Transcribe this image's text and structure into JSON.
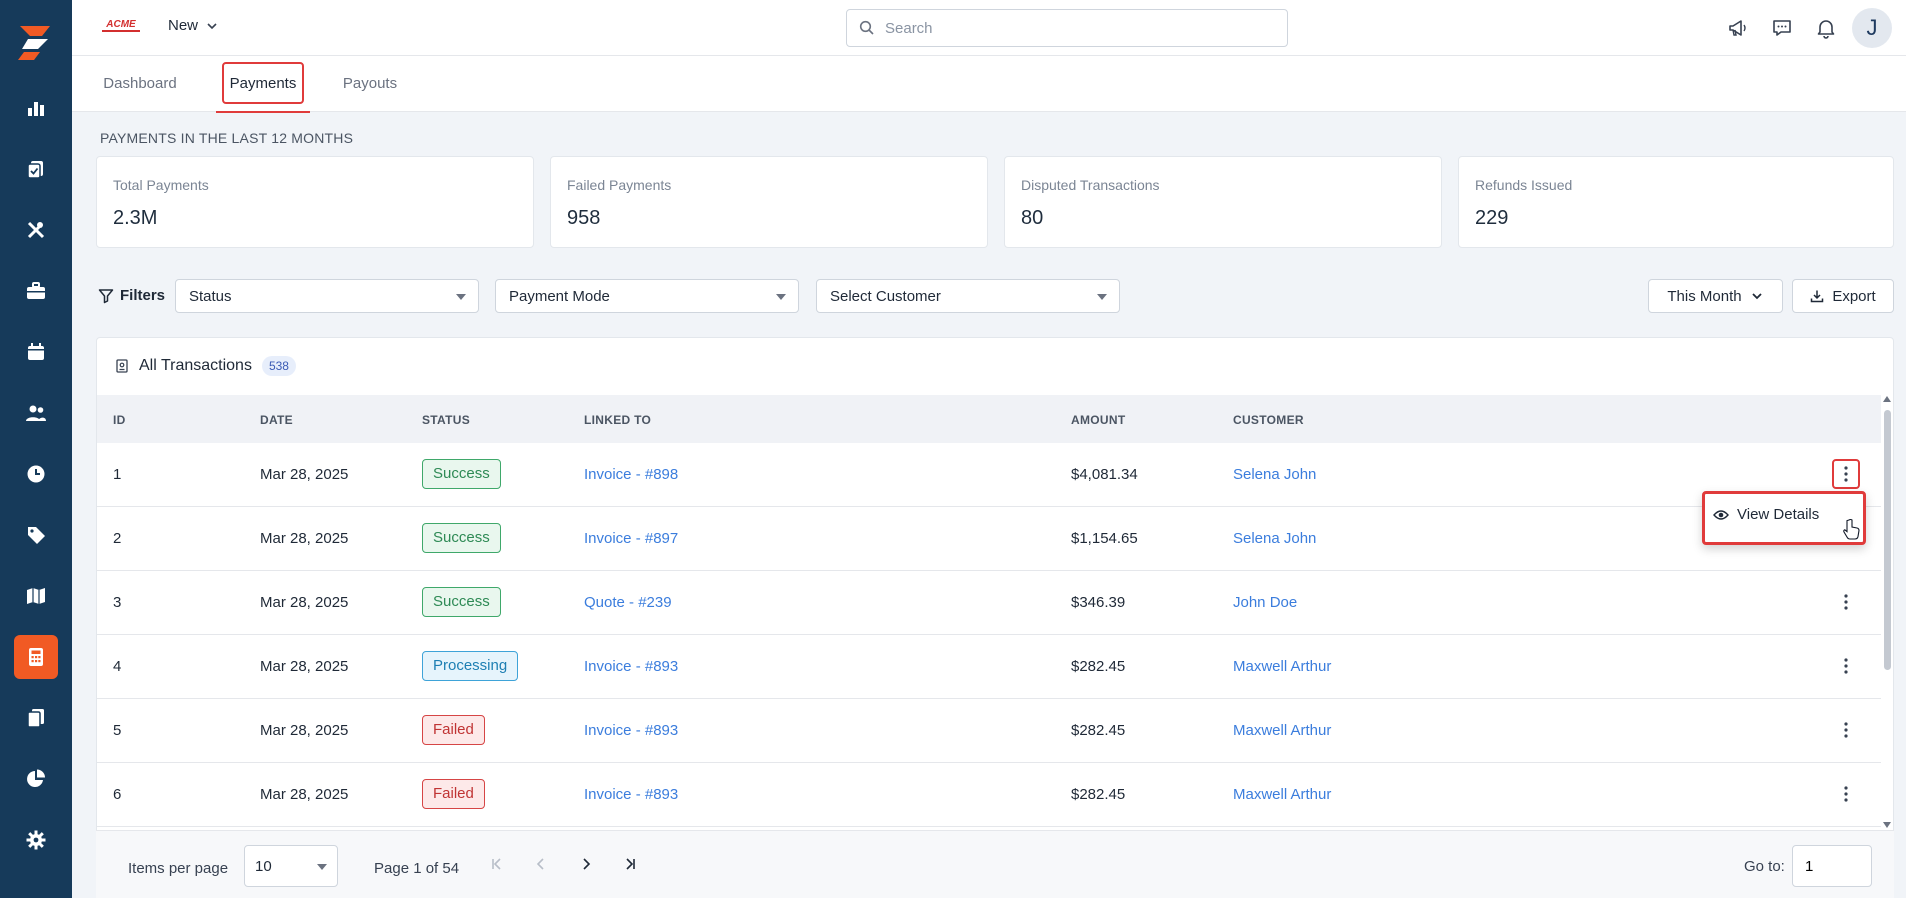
{
  "brand": {
    "logo_text": "ACME",
    "primary_color": "#163a5a",
    "accent_color": "#f15a24",
    "highlight_color": "#e03b3b"
  },
  "sidebar": {
    "items": [
      {
        "icon": "bar-chart-icon",
        "active": false
      },
      {
        "icon": "clipboard-check-icon",
        "active": false
      },
      {
        "icon": "tools-icon",
        "active": false
      },
      {
        "icon": "briefcase-icon",
        "active": false
      },
      {
        "icon": "calendar-icon",
        "active": false
      },
      {
        "icon": "users-icon",
        "active": false
      },
      {
        "icon": "clock-icon",
        "active": false
      },
      {
        "icon": "tag-icon",
        "active": false
      },
      {
        "icon": "map-icon",
        "active": false
      },
      {
        "icon": "calculator-icon",
        "active": true
      },
      {
        "icon": "documents-icon",
        "active": false
      },
      {
        "icon": "pie-chart-icon",
        "active": false
      },
      {
        "icon": "gear-icon",
        "active": false
      }
    ]
  },
  "header": {
    "new_label": "New",
    "search_placeholder": "Search",
    "avatar_initial": "J",
    "icons": [
      "megaphone-icon",
      "chat-icon",
      "bell-icon"
    ]
  },
  "tabs": [
    {
      "label": "Dashboard",
      "active": false
    },
    {
      "label": "Payments",
      "active": true
    },
    {
      "label": "Payouts",
      "active": false
    }
  ],
  "summary": {
    "title": "PAYMENTS IN THE LAST 12 MONTHS",
    "cards": [
      {
        "label": "Total Payments",
        "value": "2.3M"
      },
      {
        "label": "Failed Payments",
        "value": "958"
      },
      {
        "label": "Disputed Transactions",
        "value": "80"
      },
      {
        "label": "Refunds Issued",
        "value": "229"
      }
    ]
  },
  "filters": {
    "label": "Filters",
    "status": "Status",
    "payment_mode": "Payment Mode",
    "customer": "Select Customer",
    "period": "This Month",
    "export_label": "Export"
  },
  "transactions": {
    "title": "All Transactions",
    "count": "538",
    "columns": [
      "ID",
      "DATE",
      "STATUS",
      "LINKED TO",
      "AMOUNT",
      "CUSTOMER"
    ],
    "rows": [
      {
        "id": "1",
        "date": "Mar 28, 2025",
        "status": "Success",
        "status_type": "success",
        "linked": "Invoice - #898",
        "amount": "$4,081.34",
        "customer": "Selena John"
      },
      {
        "id": "2",
        "date": "Mar 28, 2025",
        "status": "Success",
        "status_type": "success",
        "linked": "Invoice - #897",
        "amount": "$1,154.65",
        "customer": "Selena John"
      },
      {
        "id": "3",
        "date": "Mar 28, 2025",
        "status": "Success",
        "status_type": "success",
        "linked": "Quote - #239",
        "amount": "$346.39",
        "customer": "John Doe"
      },
      {
        "id": "4",
        "date": "Mar 28, 2025",
        "status": "Processing",
        "status_type": "processing",
        "linked": "Invoice - #893",
        "amount": "$282.45",
        "customer": "Maxwell Arthur"
      },
      {
        "id": "5",
        "date": "Mar 28, 2025",
        "status": "Failed",
        "status_type": "failed",
        "linked": "Invoice - #893",
        "amount": "$282.45",
        "customer": "Maxwell Arthur"
      },
      {
        "id": "6",
        "date": "Mar 28, 2025",
        "status": "Failed",
        "status_type": "failed",
        "linked": "Invoice - #893",
        "amount": "$282.45",
        "customer": "Maxwell Arthur"
      }
    ]
  },
  "context_menu": {
    "item_label": "View Details",
    "item_icon": "eye-icon"
  },
  "pagination": {
    "items_per_page_label": "Items per page",
    "items_per_page": "10",
    "page_info": "Page 1 of 54",
    "goto_label": "Go to:",
    "goto_value": "1"
  }
}
